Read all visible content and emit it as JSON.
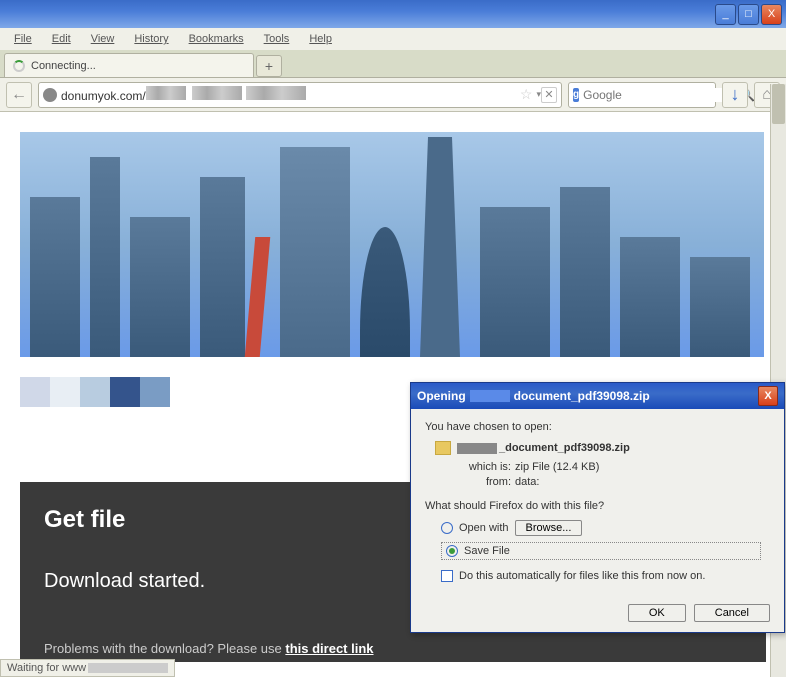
{
  "window": {
    "minimize": "_",
    "maximize": "□",
    "close": "X"
  },
  "menu": {
    "file": "File",
    "edit": "Edit",
    "view": "View",
    "history": "History",
    "bookmarks": "Bookmarks",
    "tools": "Tools",
    "help": "Help"
  },
  "tab": {
    "label": "Connecting...",
    "newtab": "+"
  },
  "nav": {
    "back": "←",
    "url_host": "donumyok.com/",
    "star": "☆",
    "dropdown": "▾",
    "stop": "✕",
    "search_engine": "g",
    "search_placeholder": "Google",
    "magnifier": "🔍",
    "download": "↓",
    "home": "⌂"
  },
  "colorbar": [
    "#d0d8e8",
    "#e8eef4",
    "#b8cce0",
    "#34548c",
    "#7a9cc4"
  ],
  "panel": {
    "title": "Get file",
    "subtitle": "Download started.",
    "problems_prefix": "Problems with the download? Please use ",
    "problems_link": "this direct link"
  },
  "status": {
    "prefix": "Waiting for www"
  },
  "dialog": {
    "title_prefix": "Opening",
    "title_file": "document_pdf39098.zip",
    "chosen": "You have chosen to open:",
    "filename_suffix": "_document_pdf39098.zip",
    "which_label": "which is:",
    "which_value": "zip File (12.4 KB)",
    "from_label": "from:",
    "from_value": "data:",
    "question": "What should Firefox do with this file?",
    "open_with": "Open with",
    "browse": "Browse...",
    "save_file": "Save File",
    "auto": "Do this automatically for files like this from now on.",
    "ok": "OK",
    "cancel": "Cancel",
    "close": "X"
  }
}
